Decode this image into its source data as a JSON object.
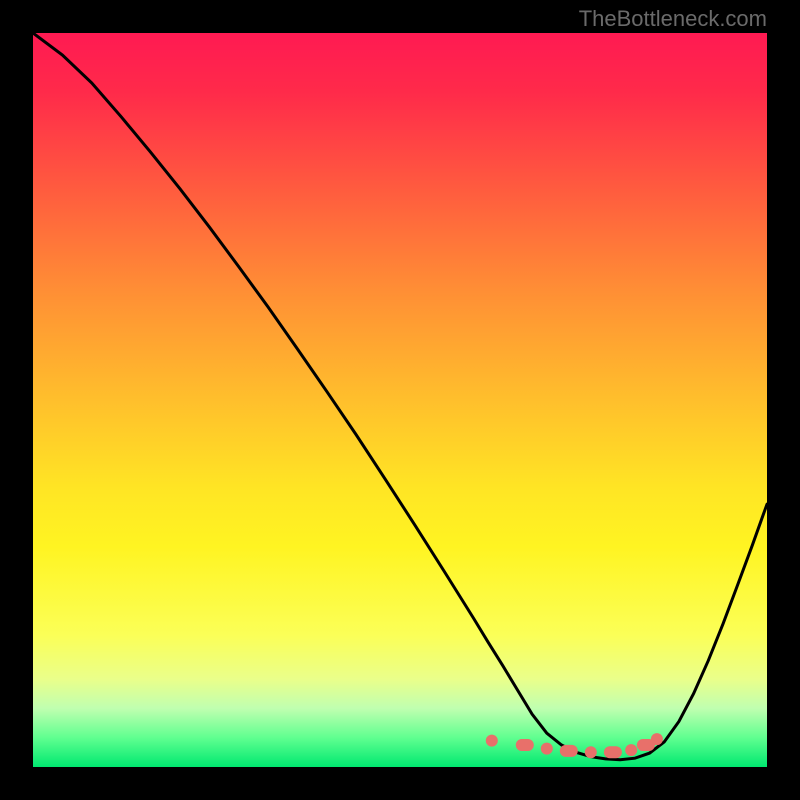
{
  "attribution": "TheBottleneck.com",
  "chart_data": {
    "type": "line",
    "title": "",
    "xlabel": "",
    "ylabel": "",
    "xlim": [
      0,
      100
    ],
    "ylim": [
      0,
      100
    ],
    "series": [
      {
        "name": "curve",
        "x": [
          0,
          4,
          8,
          12,
          16,
          20,
          24,
          28,
          32,
          36,
          40,
          44,
          48,
          52,
          56,
          60,
          62,
          64,
          66,
          68,
          70,
          72,
          74,
          76,
          78,
          80,
          82,
          84,
          86,
          88,
          90,
          92,
          94,
          96,
          98,
          100
        ],
        "y": [
          100,
          97.0,
          93.2,
          88.6,
          83.8,
          78.8,
          73.6,
          68.2,
          62.7,
          57.0,
          51.2,
          45.3,
          39.2,
          33.0,
          26.7,
          20.3,
          17.0,
          13.8,
          10.5,
          7.2,
          4.6,
          3.0,
          2.0,
          1.4,
          1.1,
          1.0,
          1.2,
          1.9,
          3.4,
          6.2,
          10.0,
          14.5,
          19.5,
          24.8,
          30.2,
          35.8
        ]
      },
      {
        "name": "highlight-dots",
        "x": [
          62.5,
          67,
          70,
          73,
          76,
          79,
          81.5,
          83.5,
          85
        ],
        "y": [
          3.6,
          3.0,
          2.5,
          2.2,
          2.0,
          2.0,
          2.3,
          3.0,
          3.8
        ]
      }
    ]
  }
}
